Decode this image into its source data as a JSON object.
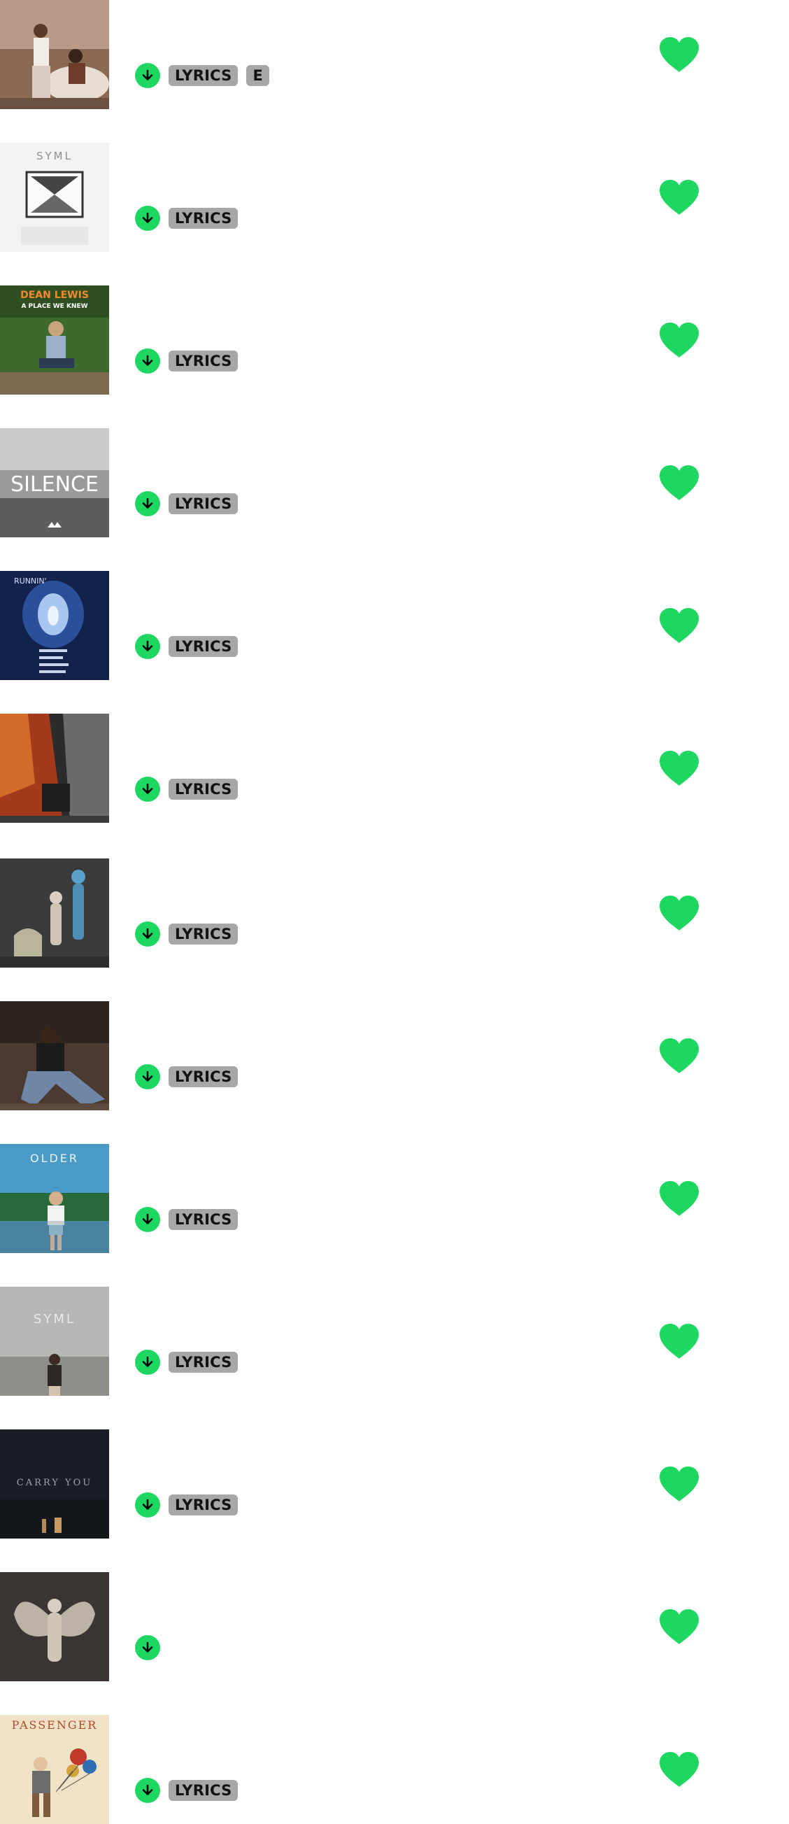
{
  "colors": {
    "accent": "#1ed760",
    "badge_bg": "#a7a7a7",
    "badge_text": "#121212",
    "background": "#ffffff"
  },
  "icons": {
    "download": "arrow-down-circle-icon",
    "like": "heart-filled-icon"
  },
  "tracks": [
    {
      "cover_text": "",
      "lyrics_label": "LYRICS",
      "explicit_label": "E",
      "liked": true,
      "downloaded": true
    },
    {
      "cover_text": "SYML",
      "lyrics_label": "LYRICS",
      "liked": true,
      "downloaded": true
    },
    {
      "cover_text": "DEAN LEWIS",
      "cover_subtext": "A PLACE WE KNEW",
      "lyrics_label": "LYRICS",
      "liked": true,
      "downloaded": true
    },
    {
      "cover_text": "SILENCE",
      "lyrics_label": "LYRICS",
      "liked": true,
      "downloaded": true
    },
    {
      "cover_text": "RUNNIN'",
      "lyrics_label": "LYRICS",
      "liked": true,
      "downloaded": true
    },
    {
      "cover_text": "",
      "lyrics_label": "LYRICS",
      "liked": true,
      "downloaded": true
    },
    {
      "cover_text": "",
      "lyrics_label": "LYRICS",
      "liked": true,
      "downloaded": true
    },
    {
      "cover_text": "",
      "lyrics_label": "LYRICS",
      "liked": true,
      "downloaded": true
    },
    {
      "cover_text": "OLDER",
      "lyrics_label": "LYRICS",
      "liked": true,
      "downloaded": true
    },
    {
      "cover_text": "SYML",
      "lyrics_label": "LYRICS",
      "liked": true,
      "downloaded": true
    },
    {
      "cover_text": "CARRY YOU",
      "lyrics_label": "LYRICS",
      "liked": true,
      "downloaded": true
    },
    {
      "cover_text": "",
      "liked": true,
      "downloaded": true
    },
    {
      "cover_text": "PASSENGER",
      "lyrics_label": "LYRICS",
      "liked": true,
      "downloaded": true
    }
  ]
}
